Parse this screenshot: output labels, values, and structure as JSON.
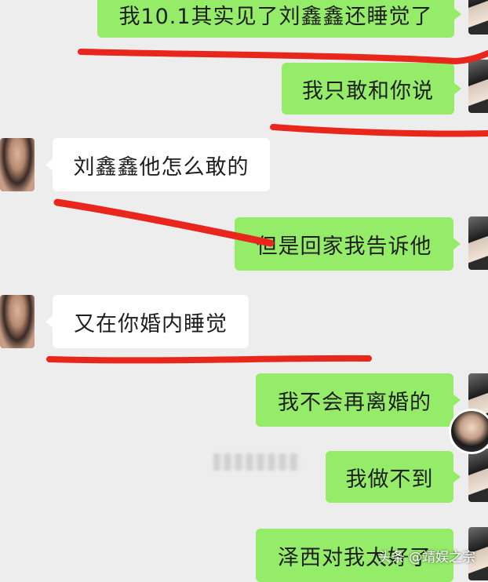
{
  "messages": [
    {
      "id": "m1",
      "side": "sent",
      "text": "我10.1其实见了刘鑫鑫还睡觉了"
    },
    {
      "id": "m2",
      "side": "sent",
      "text": "我只敢和你说"
    },
    {
      "id": "m3",
      "side": "received",
      "text": "刘鑫鑫他怎么敢的"
    },
    {
      "id": "m4",
      "side": "sent",
      "text": "但是回家我告诉他"
    },
    {
      "id": "m5",
      "side": "received",
      "text": "又在你婚内睡觉"
    },
    {
      "id": "m6",
      "side": "sent",
      "text": "我不会再离婚的"
    },
    {
      "id": "m7",
      "side": "sent",
      "text": "我做不到"
    },
    {
      "id": "m8",
      "side": "sent",
      "text": "泽西对我太好了"
    }
  ],
  "watermark": "头条 @靖娱之宗",
  "colors": {
    "sent_bubble": "#95ec69",
    "received_bubble": "#ffffff",
    "background": "#ededed",
    "annotation_underline": "#e8261b"
  },
  "icons": {
    "self_avatar": "portrait-dark-hair-icon",
    "other_avatar": "portrait-woman-icon",
    "floating_avatar": "circular-profile-icon"
  }
}
